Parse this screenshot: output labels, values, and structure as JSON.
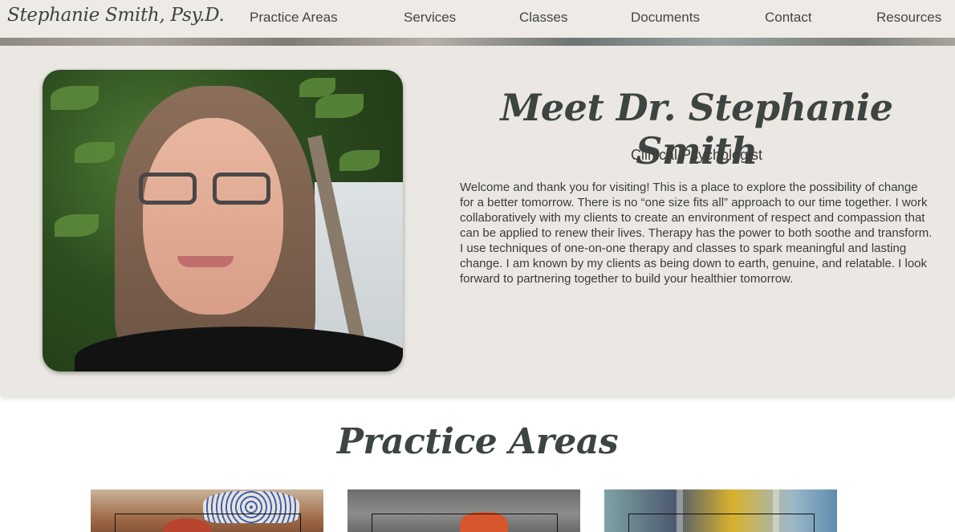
{
  "brand": "Stephanie Smith, Psy.D.",
  "nav": {
    "items": [
      "Practice Areas",
      "Services",
      "Classes",
      "Documents",
      "Contact",
      "Resources"
    ]
  },
  "hero": {
    "title": "Meet Dr. Stephanie Smith",
    "subtitle": "Clinical Psychologist",
    "body": "Welcome and thank you for visiting! This is a place to explore the possibility of change for a better tomorrow. There is no “one size fits all” approach to our time together. I work collaboratively with my clients to create an environment of respect and compassion that can be applied to renew their lives. Therapy has the power to both soothe and transform. I use techniques of one-on-one therapy and classes to spark meaningful and lasting change. I am known by my clients as being down to earth, genuine, and relatable. I look forward to partnering together to build your healthier tomorrow."
  },
  "practice": {
    "title": "Practice Areas"
  },
  "colors": {
    "nav_bg": "#eeebe6",
    "hero_bg": "#ebe8e3",
    "heading": "#3d4542"
  }
}
